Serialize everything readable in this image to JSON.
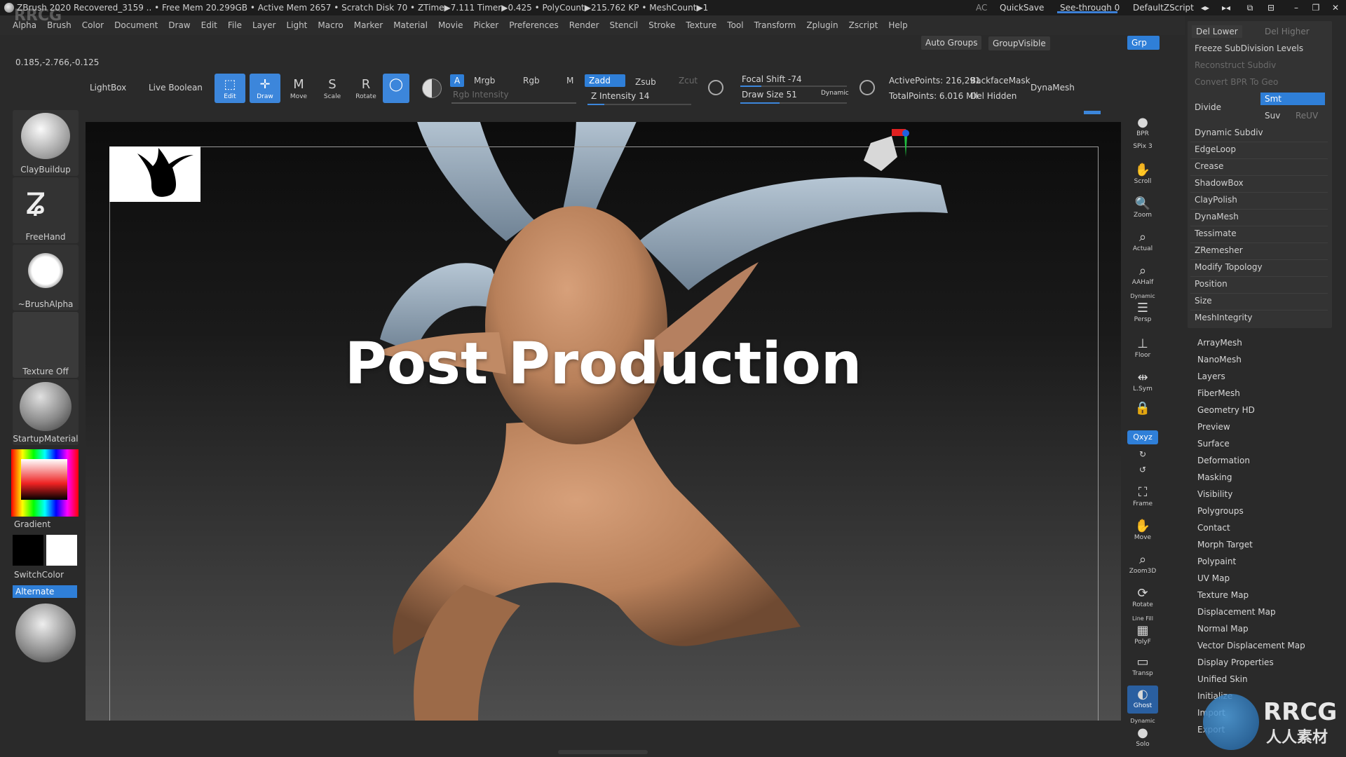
{
  "titlebar": {
    "title": "ZBrush 2020    Recovered_3159    .. • Free Mem 20.299GB • Active Mem 2657 • Scratch Disk 70 •  ZTime▶7.111 Timer▶0.425 • PolyCount▶215.762 KP  • MeshCount▶1",
    "ac": "AC",
    "quicksave": "QuickSave",
    "seethrough": "See-through  0",
    "defaultzscript": "DefaultZScript"
  },
  "menu": [
    "Alpha",
    "Brush",
    "Color",
    "Document",
    "Draw",
    "Edit",
    "File",
    "Layer",
    "Light",
    "Macro",
    "Marker",
    "Material",
    "Movie",
    "Picker",
    "Preferences",
    "Render",
    "Stencil",
    "Stroke",
    "Texture",
    "Tool",
    "Transform",
    "Zplugin",
    "Zscript",
    "Help"
  ],
  "top_buttons": {
    "auto_groups": "Auto Groups",
    "group_visible": "GroupVisible",
    "grp": "Grp"
  },
  "coords": "0.185,-2.766,-0.125",
  "shelf": {
    "lightbox": "LightBox",
    "live_boolean": "Live Boolean",
    "edit": "Edit",
    "draw": "Draw",
    "move": "Move",
    "scale": "Scale",
    "rotate": "Rotate",
    "a": "A",
    "mrgb": "Mrgb",
    "rgb": "Rgb",
    "m": "M",
    "zadd": "Zadd",
    "zsub": "Zsub",
    "zcut": "Zcut",
    "rgb_intensity": "Rgb Intensity",
    "z_intensity": "Z Intensity 14",
    "focal_shift": "Focal Shift -74",
    "draw_size": "Draw Size 51",
    "dynamic": "Dynamic",
    "active_points": "ActivePoints: 216,291",
    "total_points": "TotalPoints: 6.016 Mil",
    "backface_mask": "BackfaceMask",
    "del_hidden": "Del Hidden",
    "dynamesh": "DynaMesh"
  },
  "left": {
    "brush": "ClayBuildup",
    "stroke": "FreeHand",
    "alpha": "~BrushAlpha",
    "texture": "Texture Off",
    "material": "StartupMaterial",
    "gradient": "Gradient",
    "switchcolor": "SwitchColor",
    "alternate": "Alternate"
  },
  "viewport": {
    "overlay_title": "Post Production"
  },
  "right_toolbar": {
    "bpr": "BPR",
    "spix": "SPix 3",
    "scroll": "Scroll",
    "zoom": "Zoom",
    "actual": "Actual",
    "aahalf": "AAHalf",
    "dynamic": "Dynamic",
    "persp": "Persp",
    "floor": "Floor",
    "lsym": "L.Sym",
    "xyz": "Qxyz",
    "frame": "Frame",
    "move": "Move",
    "zoom3d": "Zoom3D",
    "rotate": "Rotate",
    "linefill": "Line Fill",
    "polyf": "PolyF",
    "transp": "Transp",
    "ghost": "Ghost",
    "solo": "Solo",
    "dynamic2": "Dynamic"
  },
  "geometry_panel": {
    "del_lower": "Del Lower",
    "del_higher": "Del Higher",
    "freeze": "Freeze SubDivision Levels",
    "reconstruct": "Reconstruct Subdiv",
    "convert_bpr": "Convert BPR To Geo",
    "divide": "Divide",
    "smt": "Smt",
    "suv": "Suv",
    "reuv": "ReUV",
    "subitems": [
      "Dynamic Subdiv",
      "EdgeLoop",
      "Crease",
      "ShadowBox",
      "ClayPolish",
      "DynaMesh",
      "Tessimate",
      "ZRemesher",
      "Modify Topology",
      "Position",
      "Size",
      "MeshIntegrity"
    ]
  },
  "tool_menu": [
    "ArrayMesh",
    "NanoMesh",
    "Layers",
    "FiberMesh",
    "Geometry HD",
    "Preview",
    "Surface",
    "Deformation",
    "Masking",
    "Visibility",
    "Polygroups",
    "Contact",
    "Morph Target",
    "Polypaint",
    "UV Map",
    "Texture Map",
    "Displacement Map",
    "Normal Map",
    "Vector Displacement Map",
    "Display Properties",
    "Unified Skin",
    "Initialize",
    "Import",
    "Export"
  ],
  "watermark": {
    "brand": "RRCG",
    "sub": "人人素材",
    "corner": "RRCG"
  },
  "colors": {
    "accent": "#2f7fd8",
    "skin": "#c9906a",
    "horn": "#8fa3b5"
  }
}
